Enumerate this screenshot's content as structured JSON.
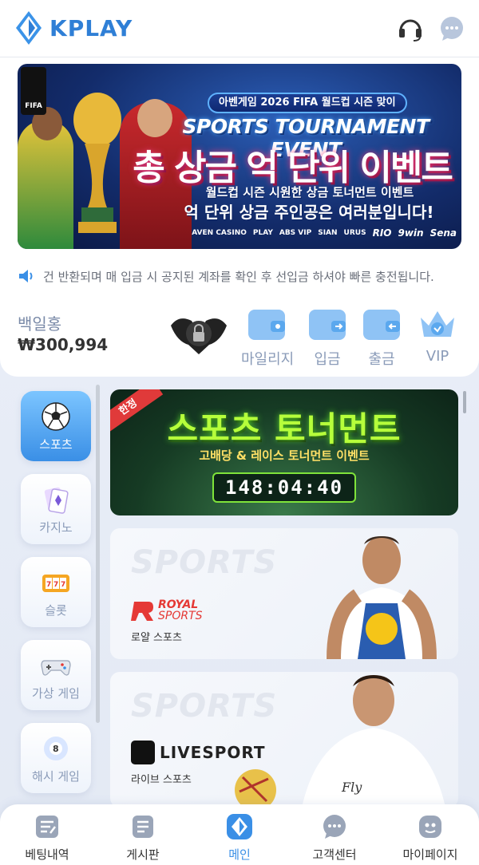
{
  "header": {
    "brand": "KPLAY"
  },
  "banner": {
    "pill": "아벤게임 2026 FIFA 월드컵 시즌 맞이",
    "title_en": "SPORTS TOURNAMENT EVENT",
    "title_kr": "총 상금 억 단위 이벤트",
    "sub1": "월드컵 시즌 시원한 상금 토너먼트 이벤트",
    "sub2": "억 단위 상금 주인공은 여러분입니다!",
    "badge": "FIFA",
    "sponsors": [
      "AVEN CASINO",
      "PLAY",
      "ABS VIP",
      "SIAN",
      "URUS",
      "RIO",
      "9win",
      "Sena"
    ]
  },
  "notice": {
    "text": "건 반환되며 매 입금 시 공지된 계좌를 확인 후 선입금 하셔야 빠른 충전됩니다."
  },
  "user": {
    "name": "백일홍",
    "balance": "₩300,994",
    "actions": [
      {
        "label": "마일리지",
        "icon": "mileage-wallet-icon"
      },
      {
        "label": "입금",
        "icon": "deposit-wallet-icon"
      },
      {
        "label": "출금",
        "icon": "withdraw-wallet-icon"
      },
      {
        "label": "VIP",
        "icon": "vip-crown-icon"
      }
    ]
  },
  "sidebar": {
    "items": [
      {
        "label": "스포츠",
        "icon": "soccer-ball-icon",
        "active": true
      },
      {
        "label": "카지노",
        "icon": "cards-icon",
        "active": false
      },
      {
        "label": "슬롯",
        "icon": "slot-machine-icon",
        "active": false
      },
      {
        "label": "가상 게임",
        "icon": "gamepad-icon",
        "active": false
      },
      {
        "label": "해시 게임",
        "icon": "billiard-ball-icon",
        "active": false
      }
    ]
  },
  "promo": {
    "tag": "한정",
    "title": "스포츠 토너먼트",
    "subtitle": "고배당 & 레이스 토너먼트 이벤트",
    "timer": "148:04:40"
  },
  "sport_cards": [
    {
      "watermark": "SPORTS",
      "logo_line1": "ROYAL",
      "logo_line2": "SPORTS",
      "name": "로얄 스포츠"
    },
    {
      "watermark": "SPORTS",
      "logo": "LIVESPORT",
      "name": "라이브 스포츠"
    }
  ],
  "tabbar": {
    "items": [
      {
        "label": "베팅내역",
        "icon": "betting-history-icon"
      },
      {
        "label": "게시판",
        "icon": "board-icon"
      },
      {
        "label": "메인",
        "icon": "main-logo-icon",
        "active": true
      },
      {
        "label": "고객센터",
        "icon": "customer-center-icon"
      },
      {
        "label": "마이페이지",
        "icon": "my-page-icon"
      }
    ]
  },
  "colors": {
    "accent": "#3a8fe6",
    "brand": "#2f7fd6",
    "muted": "#8a9bb8"
  }
}
